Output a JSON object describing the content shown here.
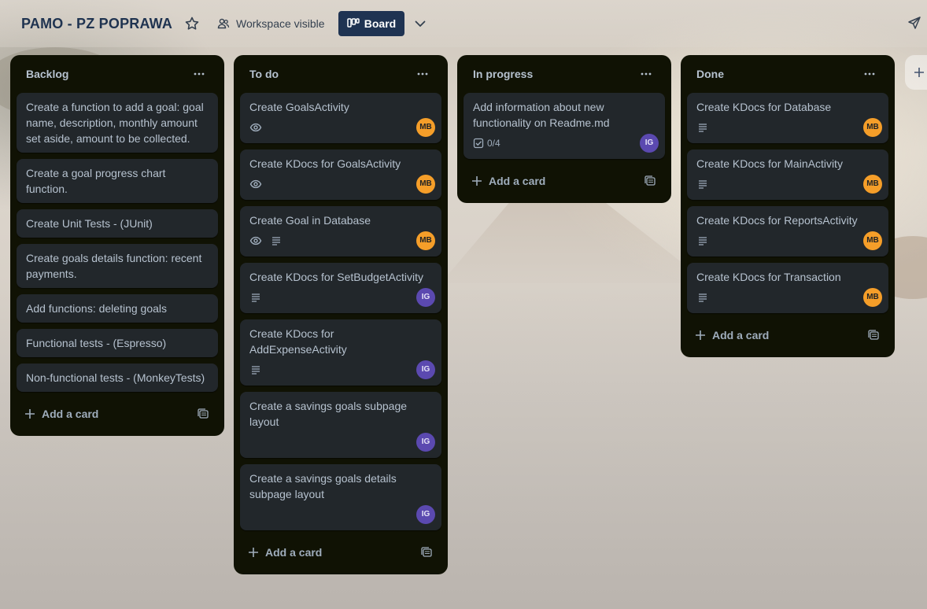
{
  "header": {
    "board_title": "PAMO - PZ POPRAWA",
    "visibility_label": "Workspace visible",
    "view_button_label": "Board"
  },
  "lists": [
    {
      "title": "Backlog",
      "add_card_label": "Add a card",
      "cards": [
        {
          "title": "Create a function to add a goal: goal name, description, monthly amount set aside, amount to be collected."
        },
        {
          "title": "Create a goal progress chart function."
        },
        {
          "title": "Create Unit Tests - (JUnit)"
        },
        {
          "title": "Create goals details function: recent payments."
        },
        {
          "title": "Add functions: deleting goals"
        },
        {
          "title": "Functional tests - (Espresso)"
        },
        {
          "title": "Non-functional tests - (MonkeyTests)"
        }
      ]
    },
    {
      "title": "To do",
      "add_card_label": "Add a card",
      "cards": [
        {
          "title": "Create GoalsActivity",
          "member": "MB"
        },
        {
          "title": "Create KDocs for GoalsActivity",
          "member": "MB"
        },
        {
          "title": "Create Goal in Database",
          "member": "MB"
        },
        {
          "title": "Create KDocs for SetBudgetActivity",
          "member": "IG"
        },
        {
          "title": "Create KDocs for AddExpenseActivity",
          "member": "IG"
        },
        {
          "title": "Create a savings goals subpage layout",
          "member": "IG"
        },
        {
          "title": "Create a savings goals details subpage layout",
          "member": "IG"
        }
      ]
    },
    {
      "title": "In progress",
      "add_card_label": "Add a card",
      "cards": [
        {
          "title": "Add information about new functionality on Readme.md",
          "checklist": "0/4",
          "member": "IG"
        }
      ]
    },
    {
      "title": "Done",
      "add_card_label": "Add a card",
      "cards": [
        {
          "title": "Create KDocs for Database",
          "member": "MB"
        },
        {
          "title": "Create KDocs for MainActivity",
          "member": "MB"
        },
        {
          "title": "Create KDocs for ReportsActivity",
          "member": "MB"
        },
        {
          "title": "Create KDocs for Transaction",
          "member": "MB"
        }
      ]
    }
  ],
  "colors": {
    "list_bg": "#101204",
    "card_bg": "#22272b",
    "card_text": "#b6c2cf",
    "board_button_bg": "#1f3352",
    "avatar_mb": "#f59e29",
    "avatar_ig": "#5b49b0"
  }
}
